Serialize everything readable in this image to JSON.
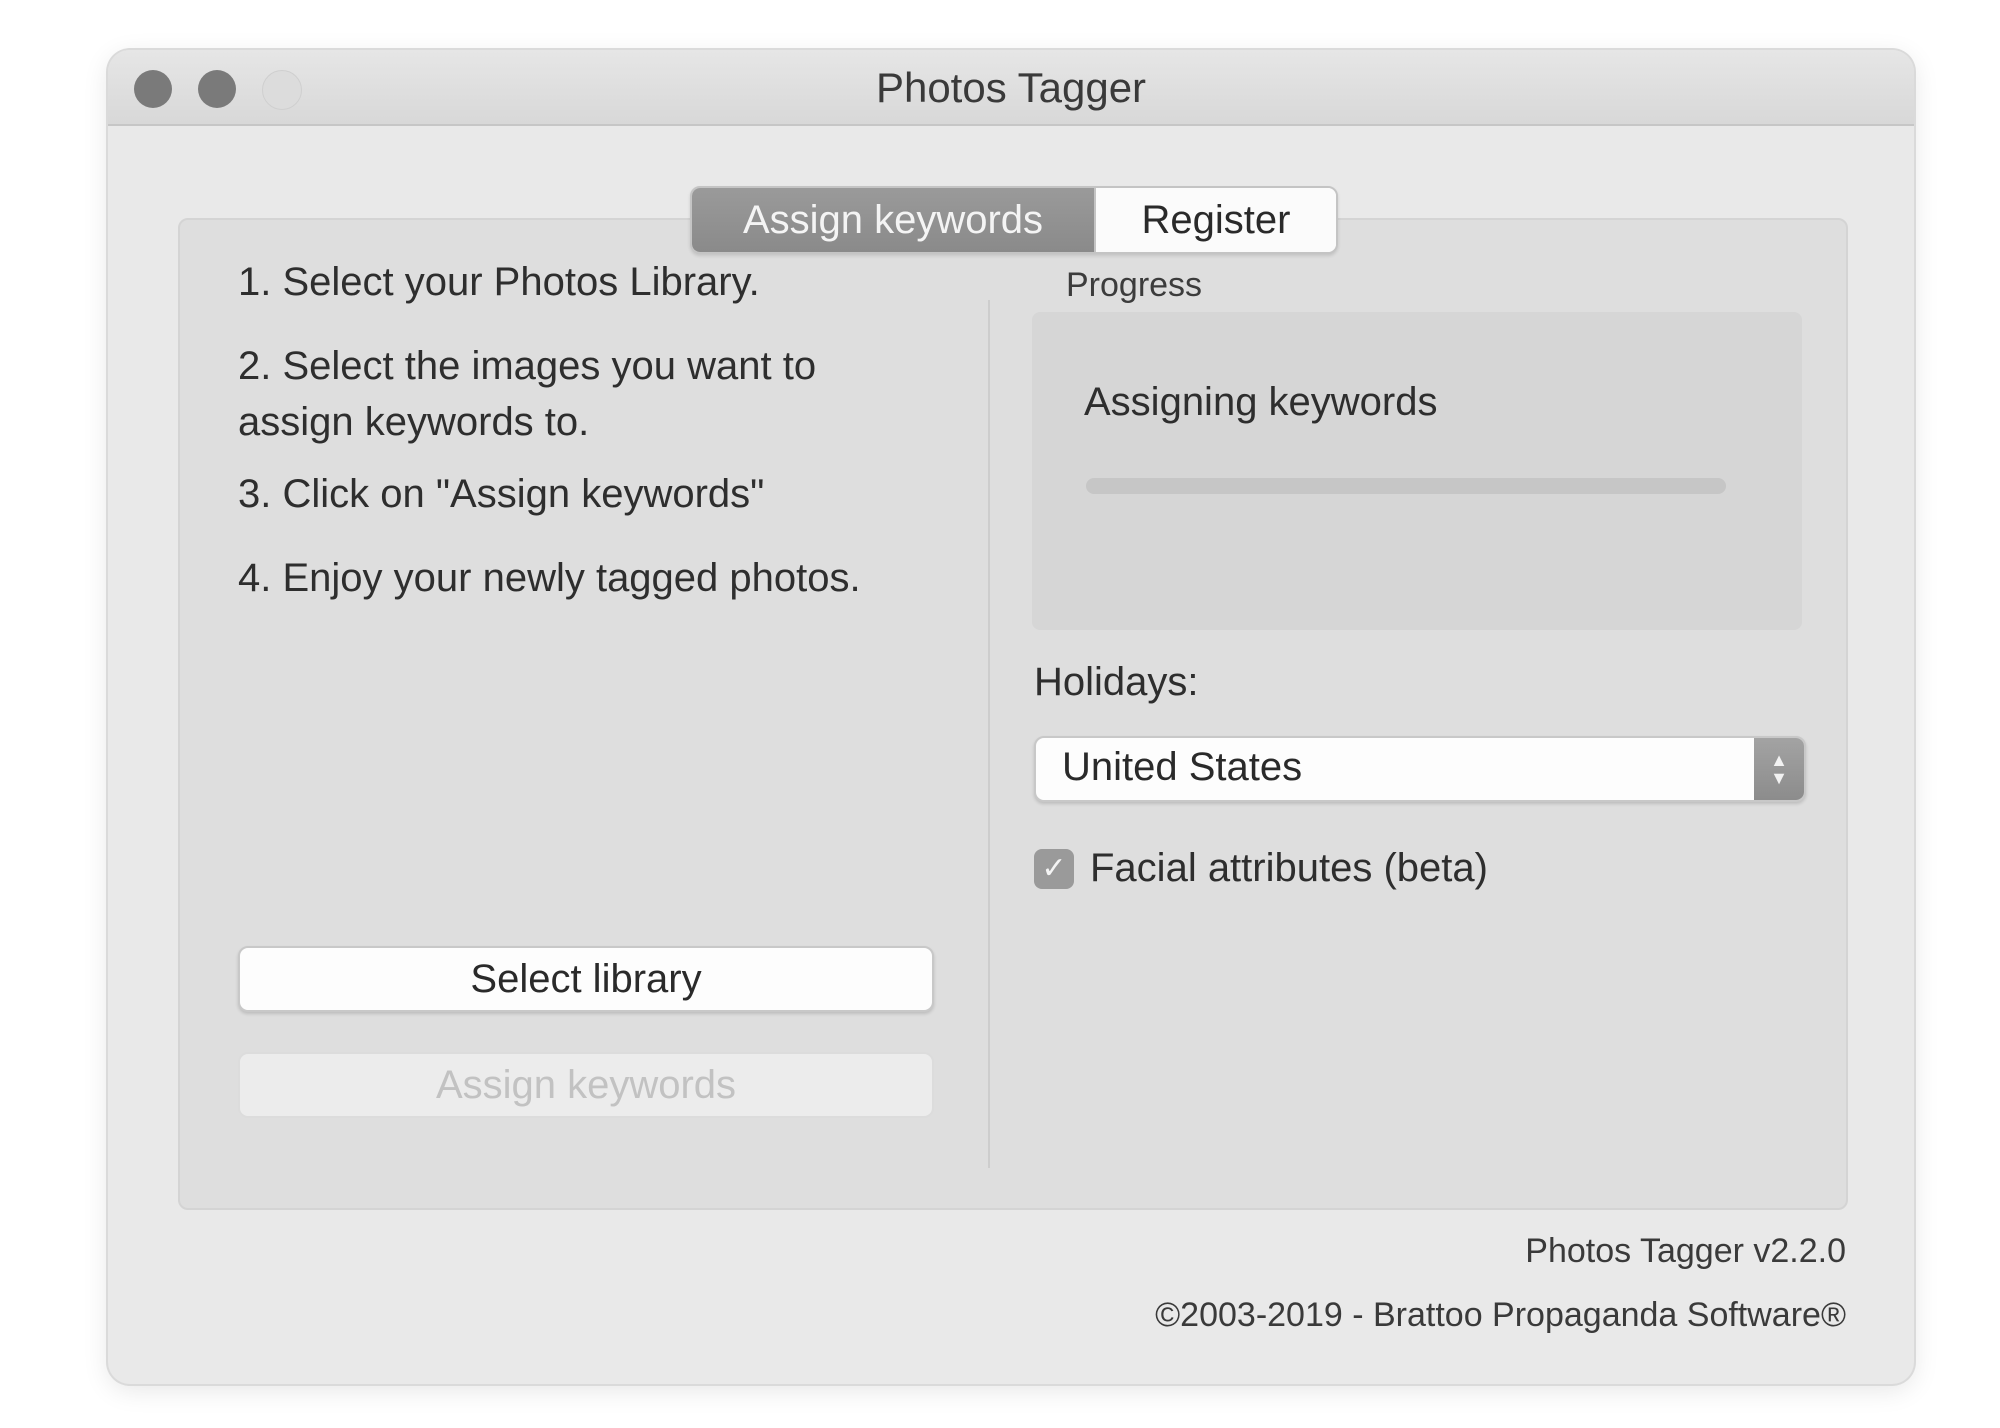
{
  "window": {
    "title": "Photos Tagger"
  },
  "tabs": [
    {
      "label": "Assign keywords",
      "active": true
    },
    {
      "label": "Register",
      "active": false
    }
  ],
  "instructions": [
    "1. Select your Photos Library.",
    "2. Select the images you want to assign keywords to.",
    "3. Click on \"Assign keywords\"",
    "4. Enjoy your newly tagged photos."
  ],
  "buttons": {
    "select_library": "Select library",
    "assign_keywords": "Assign keywords"
  },
  "progress": {
    "label": "Progress",
    "status": "Assigning keywords",
    "value_percent": 0
  },
  "holidays": {
    "label": "Holidays:",
    "selected": "United States"
  },
  "facial_attributes": {
    "label": "Facial attributes (beta)",
    "checked": true,
    "check_glyph": "✓"
  },
  "footer": {
    "version": "Photos Tagger v2.2.0",
    "copyright": "©2003-2019 - Brattoo Propaganda Software®"
  },
  "colors": {
    "window_bg": "#e9e9e9",
    "panel_bg": "#dedede",
    "active_tab": "#8e8e8e"
  }
}
